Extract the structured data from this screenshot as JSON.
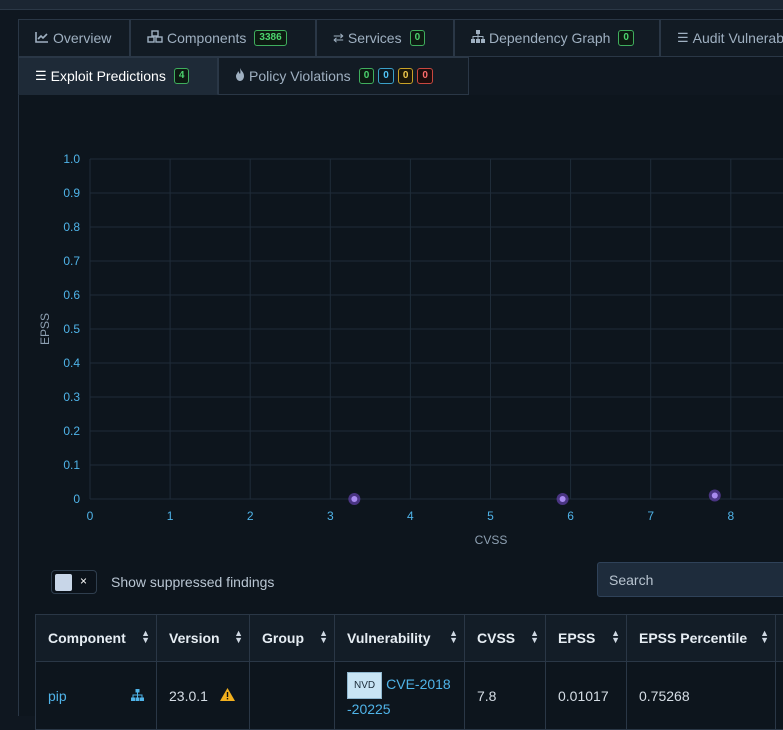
{
  "tabs": {
    "overview": {
      "label": "Overview",
      "icon": "chart-line-icon"
    },
    "components": {
      "label": "Components",
      "icon": "cubes-icon",
      "badge": "3386"
    },
    "services": {
      "label": "Services",
      "icon": "exchange-icon",
      "badge": "0"
    },
    "dependency_graph": {
      "label": "Dependency Graph",
      "icon": "sitemap-icon",
      "badge": "0"
    },
    "audit": {
      "label": "Audit Vulnerabilities",
      "icon": "tasks-icon"
    },
    "exploit": {
      "label": "Exploit Predictions",
      "icon": "tasks-icon",
      "badge": "4"
    },
    "policy": {
      "label": "Policy Violations",
      "icon": "fire-icon",
      "badges": [
        "0",
        "0",
        "0",
        "0"
      ]
    }
  },
  "chart_data": {
    "type": "scatter",
    "xlabel": "CVSS",
    "ylabel": "EPSS",
    "xlim": [
      0,
      9
    ],
    "ylim": [
      0,
      1
    ],
    "xticks": [
      "0",
      "1",
      "2",
      "3",
      "4",
      "5",
      "6",
      "7",
      "8"
    ],
    "yticks": [
      "0",
      "0.1",
      "0.2",
      "0.3",
      "0.4",
      "0.5",
      "0.6",
      "0.7",
      "0.8",
      "0.9",
      "1.0"
    ],
    "points": [
      {
        "x": 3.3,
        "y": 0.0
      },
      {
        "x": 5.9,
        "y": 0.0
      },
      {
        "x": 7.8,
        "y": 0.01017
      }
    ],
    "grid": true,
    "point_color": "#7b4fd6"
  },
  "filters": {
    "suppressed_toggle_off": "×",
    "suppressed_label": "Show suppressed findings",
    "search_placeholder": "Search"
  },
  "table": {
    "columns": [
      "Component",
      "Version",
      "Group",
      "Vulnerability",
      "CVSS",
      "EPSS",
      "EPSS Percentile"
    ],
    "rows": [
      {
        "component": "pip",
        "version": "23.0.1",
        "group": "",
        "source": "NVD",
        "vulnerability": "CVE-2018-20225",
        "cvss": "7.8",
        "epss": "0.01017",
        "epss_percentile": "0.75268"
      }
    ]
  }
}
